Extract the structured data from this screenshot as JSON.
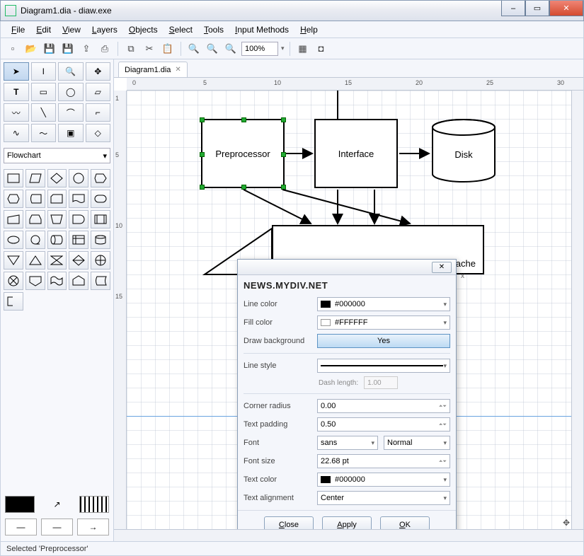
{
  "window": {
    "title": "Diagram1.dia - diaw.exe"
  },
  "menu": [
    "File",
    "Edit",
    "View",
    "Layers",
    "Objects",
    "Select",
    "Tools",
    "Input Methods",
    "Help"
  ],
  "toolbar": {
    "zoom": "100%"
  },
  "tab": {
    "label": "Diagram1.dia"
  },
  "shape_category": "Flowchart",
  "ruler_h": [
    "0",
    "5",
    "10",
    "15",
    "20",
    "25",
    "30"
  ],
  "ruler_v": [
    "1",
    "5",
    "10",
    "15"
  ],
  "diagram": {
    "preprocessor": "Preprocessor",
    "interface": "Interface",
    "disk": "Disk",
    "cache": "Local function cache"
  },
  "props": {
    "banner": "NEWS.MYDIV.NET",
    "mini_x": "x",
    "rows": {
      "line_color": {
        "label": "Line color",
        "value": "#000000"
      },
      "fill_color": {
        "label": "Fill color",
        "value": "#FFFFFF"
      },
      "draw_bg": {
        "label": "Draw background",
        "value": "Yes"
      },
      "line_style": {
        "label": "Line style",
        "value": ""
      },
      "dash": {
        "label": "Dash length:",
        "value": "1.00"
      },
      "corner": {
        "label": "Corner radius",
        "value": "0.00"
      },
      "padding": {
        "label": "Text padding",
        "value": "0.50"
      },
      "font": {
        "label": "Font",
        "name": "sans",
        "weight": "Normal"
      },
      "fontsize": {
        "label": "Font size",
        "value": "22.68 pt"
      },
      "textcolor": {
        "label": "Text color",
        "value": "#000000"
      },
      "align": {
        "label": "Text alignment",
        "value": "Center"
      }
    },
    "buttons": {
      "close": "Close",
      "apply": "Apply",
      "ok": "OK"
    }
  },
  "status": "Selected 'Preprocessor'"
}
